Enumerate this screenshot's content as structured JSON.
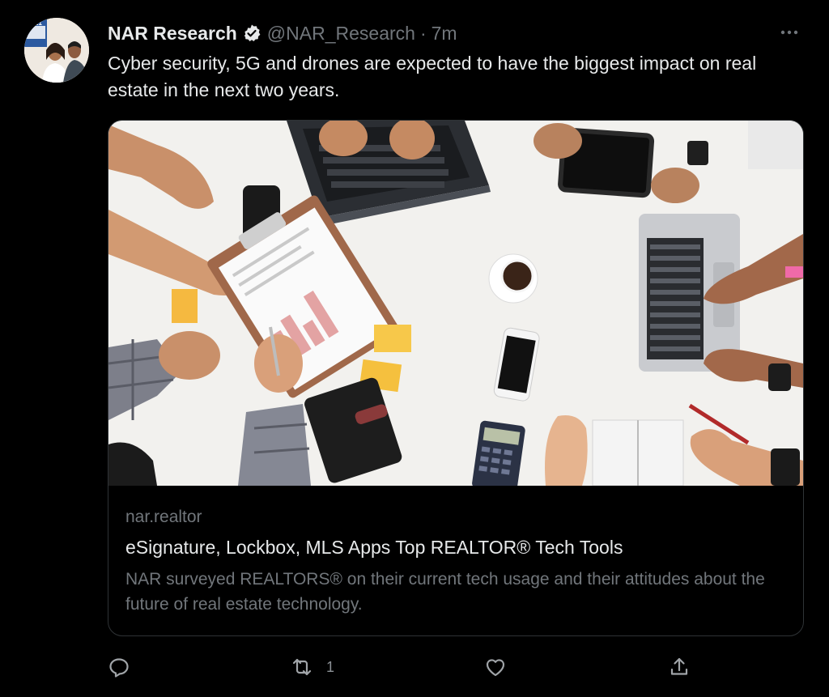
{
  "tweet": {
    "author_name": "NAR Research",
    "handle": "@NAR_Research",
    "separator": "·",
    "time": "7m",
    "text": "Cyber security, 5G and drones are expected to have the biggest impact on real estate in the next two years.",
    "avatar_badge_text": "2021"
  },
  "card": {
    "domain": "nar.realtor",
    "title": "eSignature, Lockbox, MLS Apps Top REALTOR® Tech Tools",
    "description": "NAR surveyed REALTORS® on their current tech usage and their attitudes about the future of real estate technology."
  },
  "actions": {
    "retweet_count": "1"
  },
  "icons": {
    "verified": "verified-badge-icon",
    "more": "more-icon",
    "reply": "reply-icon",
    "retweet": "retweet-icon",
    "like": "like-icon",
    "share": "share-icon"
  },
  "colors": {
    "background": "#000000",
    "primary_text": "#e7e9ea",
    "secondary_text": "#71767b",
    "border": "#2f3336"
  }
}
